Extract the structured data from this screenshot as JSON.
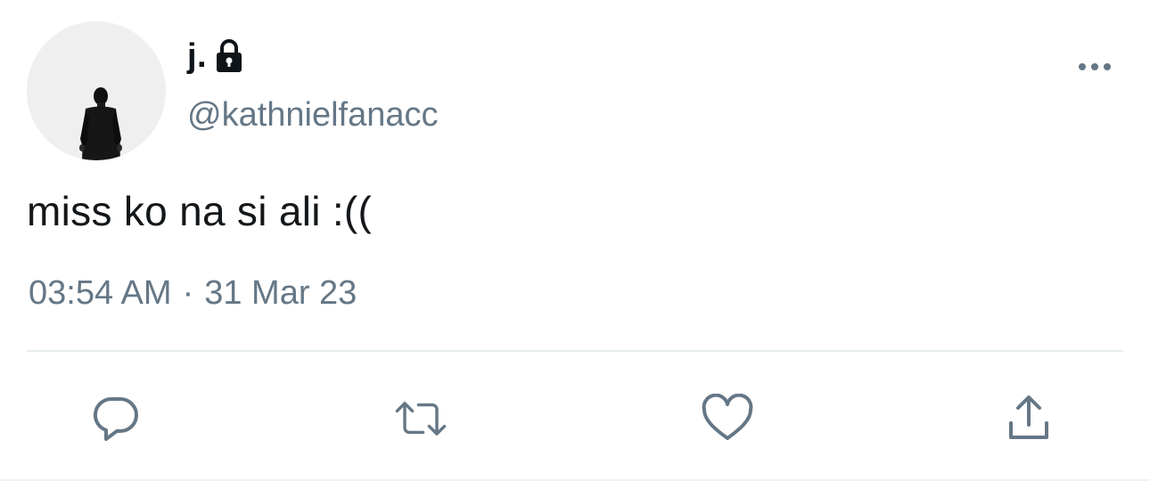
{
  "user": {
    "display_name": "j.",
    "handle": "@kathnielfanacc",
    "protected_icon": "lock-icon",
    "avatar": "avatar-person-in-suit"
  },
  "tweet": {
    "text": "miss ko na si ali :((",
    "time": "03:54 AM",
    "separator": "·",
    "date": "31 Mar 23"
  },
  "menu": {
    "icon": "more-options-icon"
  },
  "actions": [
    {
      "icon": "reply-icon"
    },
    {
      "icon": "retweet-icon"
    },
    {
      "icon": "like-icon"
    },
    {
      "icon": "share-icon"
    }
  ],
  "colors": {
    "text_primary": "#14171a",
    "text_secondary": "#657786",
    "icon": "#657786",
    "divider": "#e6ecf0"
  }
}
